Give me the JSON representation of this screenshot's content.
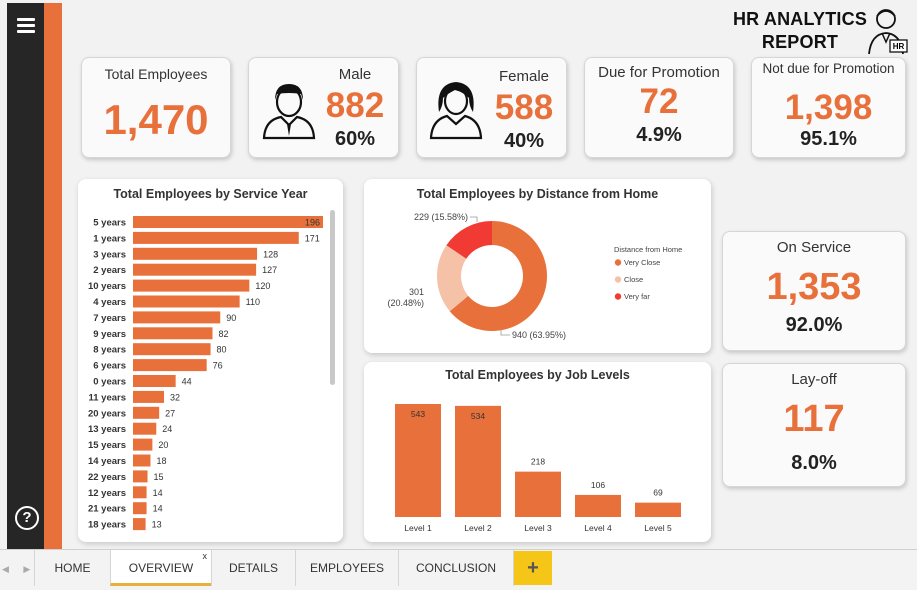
{
  "report": {
    "title": "HR ANALYTICS REPORT",
    "badge": "HR"
  },
  "kpis": {
    "total": {
      "label": "Total Employees",
      "value": "1,470"
    },
    "male": {
      "label": "Male",
      "value": "882",
      "pct": "60%"
    },
    "female": {
      "label": "Female",
      "value": "588",
      "pct": "40%"
    },
    "due_promotion": {
      "label": "Due for Promotion",
      "value": "72",
      "pct": "4.9%"
    },
    "not_due_promotion": {
      "label": "Not due for Promotion",
      "value": "1,398",
      "pct": "95.1%"
    },
    "on_service": {
      "label": "On Service",
      "value": "1,353",
      "pct": "92.0%"
    },
    "layoff": {
      "label": "Lay-off",
      "value": "117",
      "pct": "8.0%"
    }
  },
  "colors": {
    "accent": "#e8703a",
    "light": "#f5c2a8",
    "red": "#f23a34",
    "dark": "#262626",
    "add_tab": "#f5c518"
  },
  "chart_data": [
    {
      "type": "bar",
      "orientation": "horizontal",
      "title": "Total Employees by Service Year",
      "categories": [
        "5 years",
        "1 years",
        "3 years",
        "2 years",
        "10 years",
        "4 years",
        "7 years",
        "9 years",
        "8 years",
        "6 years",
        "0 years",
        "11 years",
        "20 years",
        "13 years",
        "15 years",
        "14 years",
        "22 years",
        "12 years",
        "21 years",
        "18 years"
      ],
      "values": [
        196,
        171,
        128,
        127,
        120,
        110,
        90,
        82,
        80,
        76,
        44,
        32,
        27,
        24,
        20,
        18,
        15,
        14,
        14,
        13
      ],
      "xlim": [
        0,
        196
      ]
    },
    {
      "type": "pie",
      "donut": true,
      "title": "Total Employees by Distance from Home",
      "legend_title": "Distance from Home",
      "legend_position": "right",
      "slices": [
        {
          "label": "Very Close",
          "value": 940,
          "display": "940 (63.95%)",
          "color": "#e8703a"
        },
        {
          "label": "Close",
          "value": 301,
          "display": "301 (20.48%)",
          "color": "#f5c2a8"
        },
        {
          "label": "Very far",
          "value": 229,
          "display": "229 (15.58%)",
          "color": "#f23a34"
        }
      ]
    },
    {
      "type": "bar",
      "title": "Total Employees by Job Levels",
      "categories": [
        "Level 1",
        "Level 2",
        "Level 3",
        "Level 4",
        "Level 5"
      ],
      "values": [
        543,
        534,
        218,
        106,
        69
      ],
      "ylim": [
        0,
        543
      ]
    }
  ],
  "tabs": [
    {
      "label": "HOME",
      "active": false
    },
    {
      "label": "OVERVIEW",
      "active": true,
      "close": "x"
    },
    {
      "label": "DETAILS",
      "active": false
    },
    {
      "label": "EMPLOYEES",
      "active": false
    },
    {
      "label": "CONCLUSION",
      "active": false
    }
  ],
  "add_tab_label": "+",
  "icons": {
    "menu": "hamburger-icon",
    "help": "help-icon",
    "male": "male-avatar-icon",
    "female": "female-avatar-icon",
    "hr": "hr-person-icon"
  },
  "help_glyph": "?"
}
